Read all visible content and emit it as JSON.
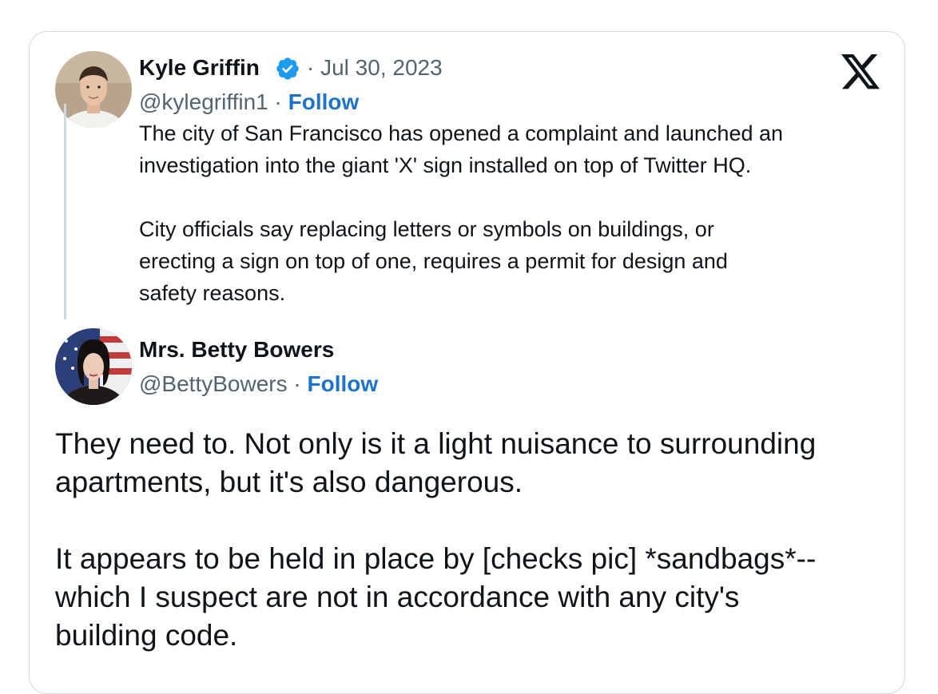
{
  "quoted_tweet": {
    "author_name": "Kyle Griffin",
    "verified": true,
    "date_sep": "·",
    "date": "Jul 30, 2023",
    "handle": "@kylegriffin1",
    "handle_sep": "·",
    "follow_label": "Follow",
    "text": "The city of San Francisco has opened a complaint and launched an\ninvestigation into the giant 'X' sign installed on top of Twitter HQ.\n\nCity officials say replacing letters or symbols on buildings, or\nerecting a sign on top of one, requires a permit for design and\nsafety reasons."
  },
  "reply_tweet": {
    "author_name": "Mrs. Betty Bowers",
    "handle": "@BettyBowers",
    "handle_sep": "·",
    "follow_label": "Follow",
    "text": "They need to. Not only is it a light nuisance to surrounding\napartments, but it's also dangerous.\n\nIt appears to be held in place by [checks pic] *sandbags*--\nwhich I suspect are not in accordance with any city's\nbuilding code."
  },
  "icons": {
    "brand": "x-logo-icon",
    "verified": "verified-badge-icon"
  },
  "colors": {
    "follow": "#1d73c9",
    "verified": "#1d9bf0",
    "border": "#cfd9de",
    "muted": "#536471",
    "text": "#0f1419"
  }
}
